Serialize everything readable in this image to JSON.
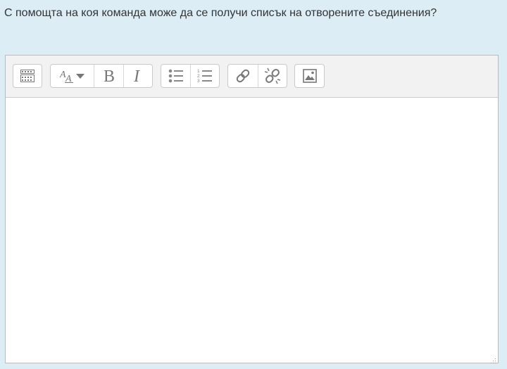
{
  "question": {
    "text": "С помощта на коя команда може да се получи списък на отворените съединения?"
  },
  "toolbar": {
    "groups": [
      {
        "buttons": [
          {
            "icon": "toolbar-toggle-icon"
          }
        ]
      },
      {
        "buttons": [
          {
            "icon": "font-style-icon"
          },
          {
            "icon": "bold-icon"
          },
          {
            "icon": "italic-icon"
          }
        ]
      },
      {
        "buttons": [
          {
            "icon": "bullet-list-icon"
          },
          {
            "icon": "numbered-list-icon"
          }
        ]
      },
      {
        "buttons": [
          {
            "icon": "link-icon"
          },
          {
            "icon": "unlink-icon"
          }
        ]
      },
      {
        "buttons": [
          {
            "icon": "image-icon"
          }
        ]
      }
    ]
  },
  "editor": {
    "content": ""
  },
  "colors": {
    "page_background": "#dcedf5",
    "toolbar_background": "#f2f2f2",
    "icon_color": "#888888"
  }
}
